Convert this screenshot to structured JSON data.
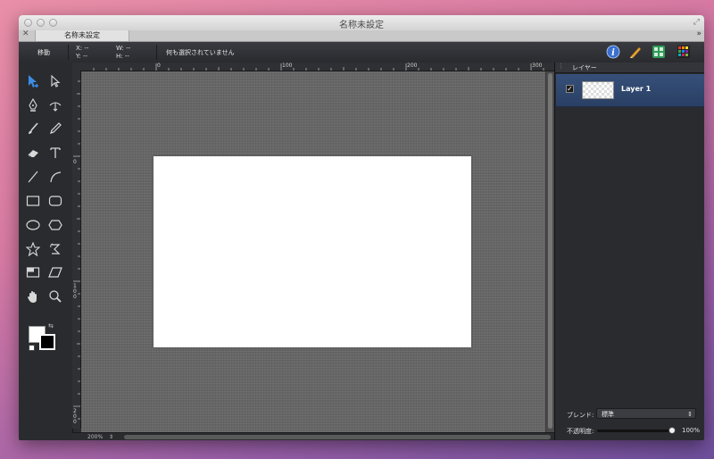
{
  "window": {
    "title": "名称未設定"
  },
  "tabs": [
    {
      "label": "名称未設定"
    }
  ],
  "toolbar": {
    "mode_label": "移動",
    "x_label": "X:",
    "x_value": "--",
    "y_label": "Y:",
    "y_value": "--",
    "w_label": "W:",
    "w_value": "--",
    "h_label": "H:",
    "h_value": "--",
    "status": "何も選択されていません",
    "buttons": [
      "info-icon",
      "pencil-ruler-icon",
      "grid-icon",
      "color-palette-icon"
    ]
  },
  "tools": [
    "selection-arrow-plus-icon",
    "direct-select-arrow-icon",
    "pen-icon",
    "anchor-convert-icon",
    "brush-icon",
    "pencil-icon",
    "eraser-icon",
    "text-icon",
    "line-icon",
    "arc-icon",
    "rectangle-icon",
    "rounded-rectangle-icon",
    "ellipse-icon",
    "hexagon-icon",
    "star-icon",
    "rotate-shape-icon",
    "split-rect-icon",
    "parallelogram-icon",
    "hand-icon",
    "zoom-icon"
  ],
  "rulers": {
    "top_labels": [
      "0",
      "100",
      "200",
      "300"
    ],
    "left_labels": [
      "0",
      "100",
      "200"
    ]
  },
  "canvas": {
    "zoom": "200%"
  },
  "layers_panel": {
    "title": "レイヤー",
    "layers": [
      {
        "name": "Layer 1",
        "visible": true
      }
    ],
    "blend_label": "ブレンド:",
    "blend_value": "標準",
    "opacity_label": "不透明度:",
    "opacity_value": "100%",
    "opacity_fraction": 1.0,
    "footer_buttons": [
      "+",
      "−",
      "⚙▾"
    ]
  },
  "colors": {
    "fill": "#ffffff",
    "stroke": "#000000",
    "selection_highlight": "#2f4a74"
  }
}
